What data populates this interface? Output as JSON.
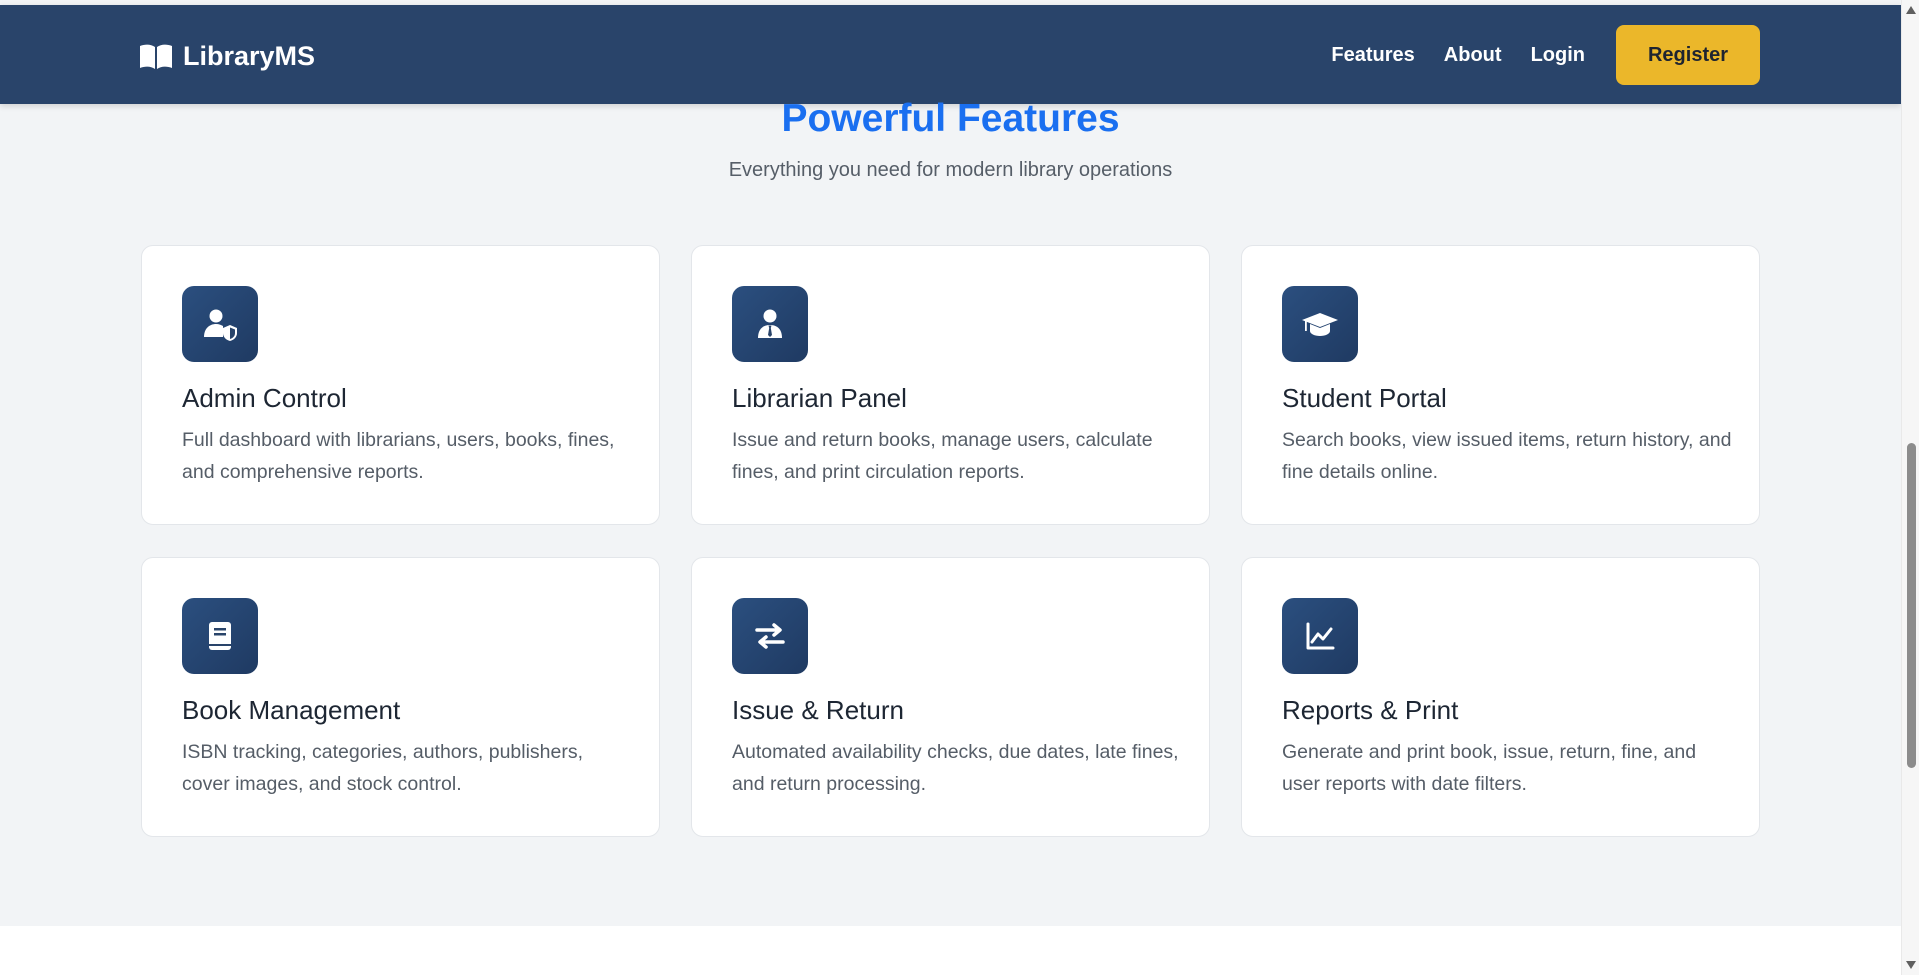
{
  "navbar": {
    "brand_name": "LibraryMS",
    "brand_icon": "open-book-icon",
    "links": [
      {
        "label": "Features"
      },
      {
        "label": "About"
      },
      {
        "label": "Login"
      }
    ],
    "register_label": "Register",
    "background_color": "#29446a",
    "accent_color": "#ebb72a"
  },
  "features": {
    "title": "Powerful Features",
    "subtitle": "Everything you need for modern library operations",
    "title_color": "#1a6ff0",
    "cards": [
      {
        "icon": "user-shield-icon",
        "title": "Admin Control",
        "description": "Full dashboard with librarians, users, books, fines, and comprehensive reports."
      },
      {
        "icon": "user-tie-icon",
        "title": "Librarian Panel",
        "description": "Issue and return books, manage users, calculate fines, and print circulation reports."
      },
      {
        "icon": "graduation-cap-icon",
        "title": "Student Portal",
        "description": "Search books, view issued items, return history, and fine details online."
      },
      {
        "icon": "book-icon",
        "title": "Book Management",
        "description": "ISBN tracking, categories, authors, publishers, cover images, and stock control."
      },
      {
        "icon": "exchange-arrows-icon",
        "title": "Issue & Return",
        "description": "Automated availability checks, due dates, late fines, and return processing."
      },
      {
        "icon": "line-chart-icon",
        "title": "Reports & Print",
        "description": "Generate and print book, issue, return, fine, and user reports with date filters."
      }
    ]
  }
}
